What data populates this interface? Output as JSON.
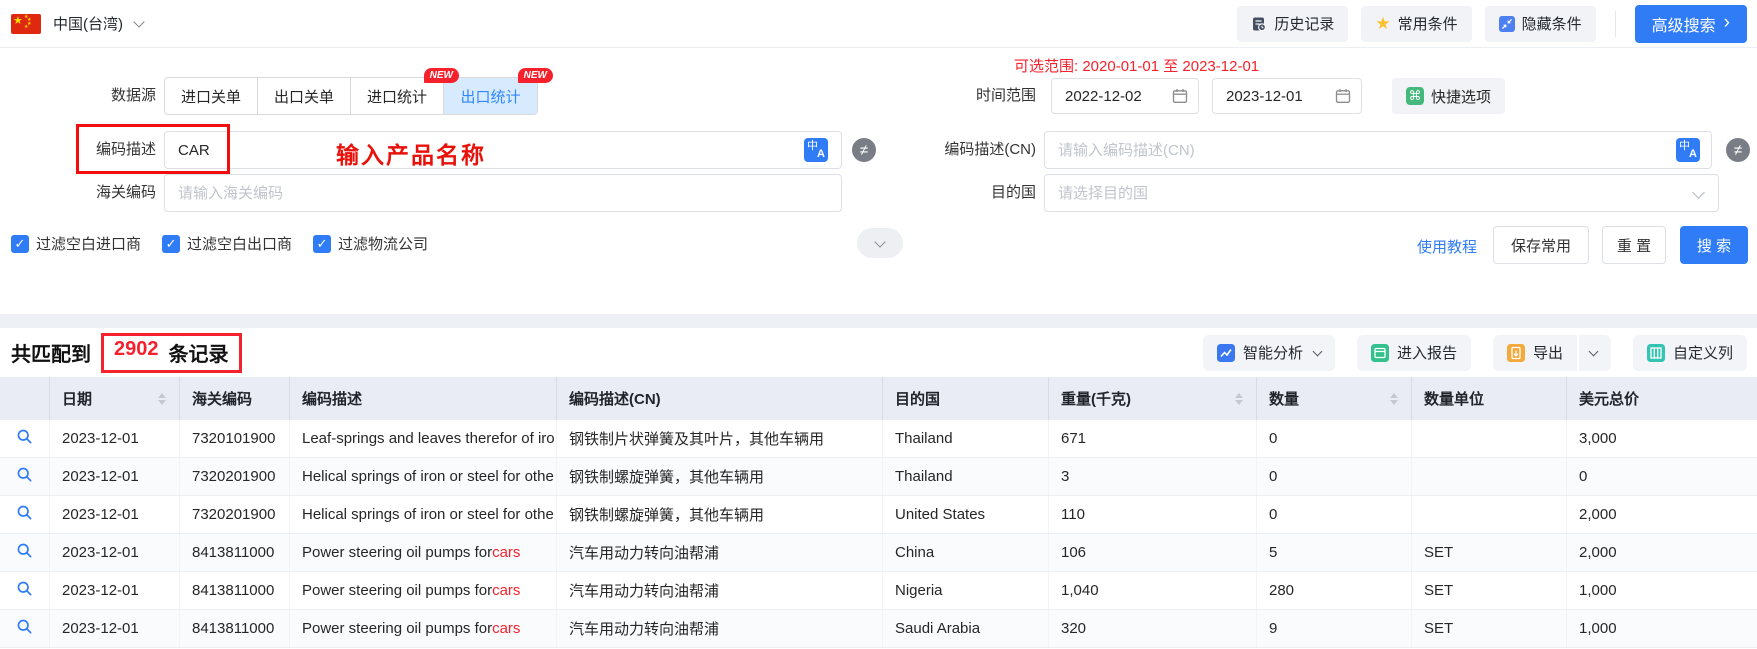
{
  "topbar": {
    "region": "中国(台湾)",
    "history_btn": "历史记录",
    "favorites_btn": "常用条件",
    "hide_btn": "隐藏条件",
    "advanced_search_btn": "高级搜索"
  },
  "filters": {
    "datasource_label": "数据源",
    "datasource_tabs": [
      {
        "label": "进口关单",
        "badge": "",
        "active": false
      },
      {
        "label": "出口关单",
        "badge": "",
        "active": false
      },
      {
        "label": "进口统计",
        "badge": "NEW",
        "active": false
      },
      {
        "label": "出口统计",
        "badge": "NEW",
        "active": true
      }
    ],
    "available_range": "可选范围: 2020-01-01 至 2023-12-01",
    "time_range_label": "时间范围",
    "date_from": "2022-12-02",
    "date_to": "2023-12-01",
    "quick_options_btn": "快捷选项",
    "desc_label": "编码描述",
    "desc_value": "CAR",
    "desc_annotation": "输入产品名称",
    "desc_cn_label": "编码描述(CN)",
    "desc_cn_placeholder": "请输入编码描述(CN)",
    "hs_code_label": "海关编码",
    "hs_code_placeholder": "请输入海关编码",
    "dest_country_label": "目的国",
    "dest_country_placeholder": "请选择目的国",
    "checkboxes": [
      {
        "label": "过滤空白进口商",
        "checked": true
      },
      {
        "label": "过滤空白出口商",
        "checked": true
      },
      {
        "label": "过滤物流公司",
        "checked": true
      }
    ],
    "tutorial_link": "使用教程",
    "save_btn": "保存常用",
    "reset_btn": "重 置",
    "search_btn": "搜 索"
  },
  "results": {
    "count_prefix": "共匹配到",
    "count": "2902",
    "count_suffix": "条记录",
    "analyze_btn": "智能分析",
    "report_btn": "进入报告",
    "export_btn": "导出",
    "columns_btn": "自定义列"
  },
  "table": {
    "columns": [
      {
        "label": "",
        "sortable": false
      },
      {
        "label": "日期",
        "sortable": true
      },
      {
        "label": "海关编码",
        "sortable": false
      },
      {
        "label": "编码描述",
        "sortable": false
      },
      {
        "label": "编码描述(CN)",
        "sortable": false
      },
      {
        "label": "目的国",
        "sortable": false
      },
      {
        "label": "重量(千克)",
        "sortable": true
      },
      {
        "label": "数量",
        "sortable": true
      },
      {
        "label": "数量单位",
        "sortable": false
      },
      {
        "label": "美元总价",
        "sortable": false
      }
    ],
    "rows": [
      {
        "date": "2023-12-01",
        "hs_code": "7320101900",
        "desc": "Leaf-springs and leaves therefor of iro",
        "desc_hl": "",
        "desc_cn": "钢铁制片状弹簧及其叶片，其他车辆用",
        "dest": "Thailand",
        "weight": "671",
        "qty": "0",
        "unit": "",
        "usd": "3,000"
      },
      {
        "date": "2023-12-01",
        "hs_code": "7320201900",
        "desc": "Helical springs of iron or steel for othe",
        "desc_hl": "",
        "desc_cn": "钢铁制螺旋弹簧，其他车辆用",
        "dest": "Thailand",
        "weight": "3",
        "qty": "0",
        "unit": "",
        "usd": "0"
      },
      {
        "date": "2023-12-01",
        "hs_code": "7320201900",
        "desc": "Helical springs of iron or steel for othe",
        "desc_hl": "",
        "desc_cn": "钢铁制螺旋弹簧，其他车辆用",
        "dest": "United States",
        "weight": "110",
        "qty": "0",
        "unit": "",
        "usd": "2,000"
      },
      {
        "date": "2023-12-01",
        "hs_code": "8413811000",
        "desc": "Power steering oil pumps for",
        "desc_hl": "cars",
        "desc_cn": "汽车用动力转向油帮浦",
        "dest": "China",
        "weight": "106",
        "qty": "5",
        "unit": "SET",
        "usd": "2,000"
      },
      {
        "date": "2023-12-01",
        "hs_code": "8413811000",
        "desc": "Power steering oil pumps for",
        "desc_hl": "cars",
        "desc_cn": "汽车用动力转向油帮浦",
        "dest": "Nigeria",
        "weight": "1,040",
        "qty": "280",
        "unit": "SET",
        "usd": "1,000"
      },
      {
        "date": "2023-12-01",
        "hs_code": "8413811000",
        "desc": "Power steering oil pumps for",
        "desc_hl": "cars",
        "desc_cn": "汽车用动力转向油帮浦",
        "dest": "Saudi Arabia",
        "weight": "320",
        "qty": "9",
        "unit": "SET",
        "usd": "1,000"
      }
    ]
  },
  "colors": {
    "primary": "#2f7cf6",
    "highlight_red": "#f5222d",
    "tab_active_bg": "#d8eafe",
    "table_header_bg": "#e9ecf5"
  }
}
